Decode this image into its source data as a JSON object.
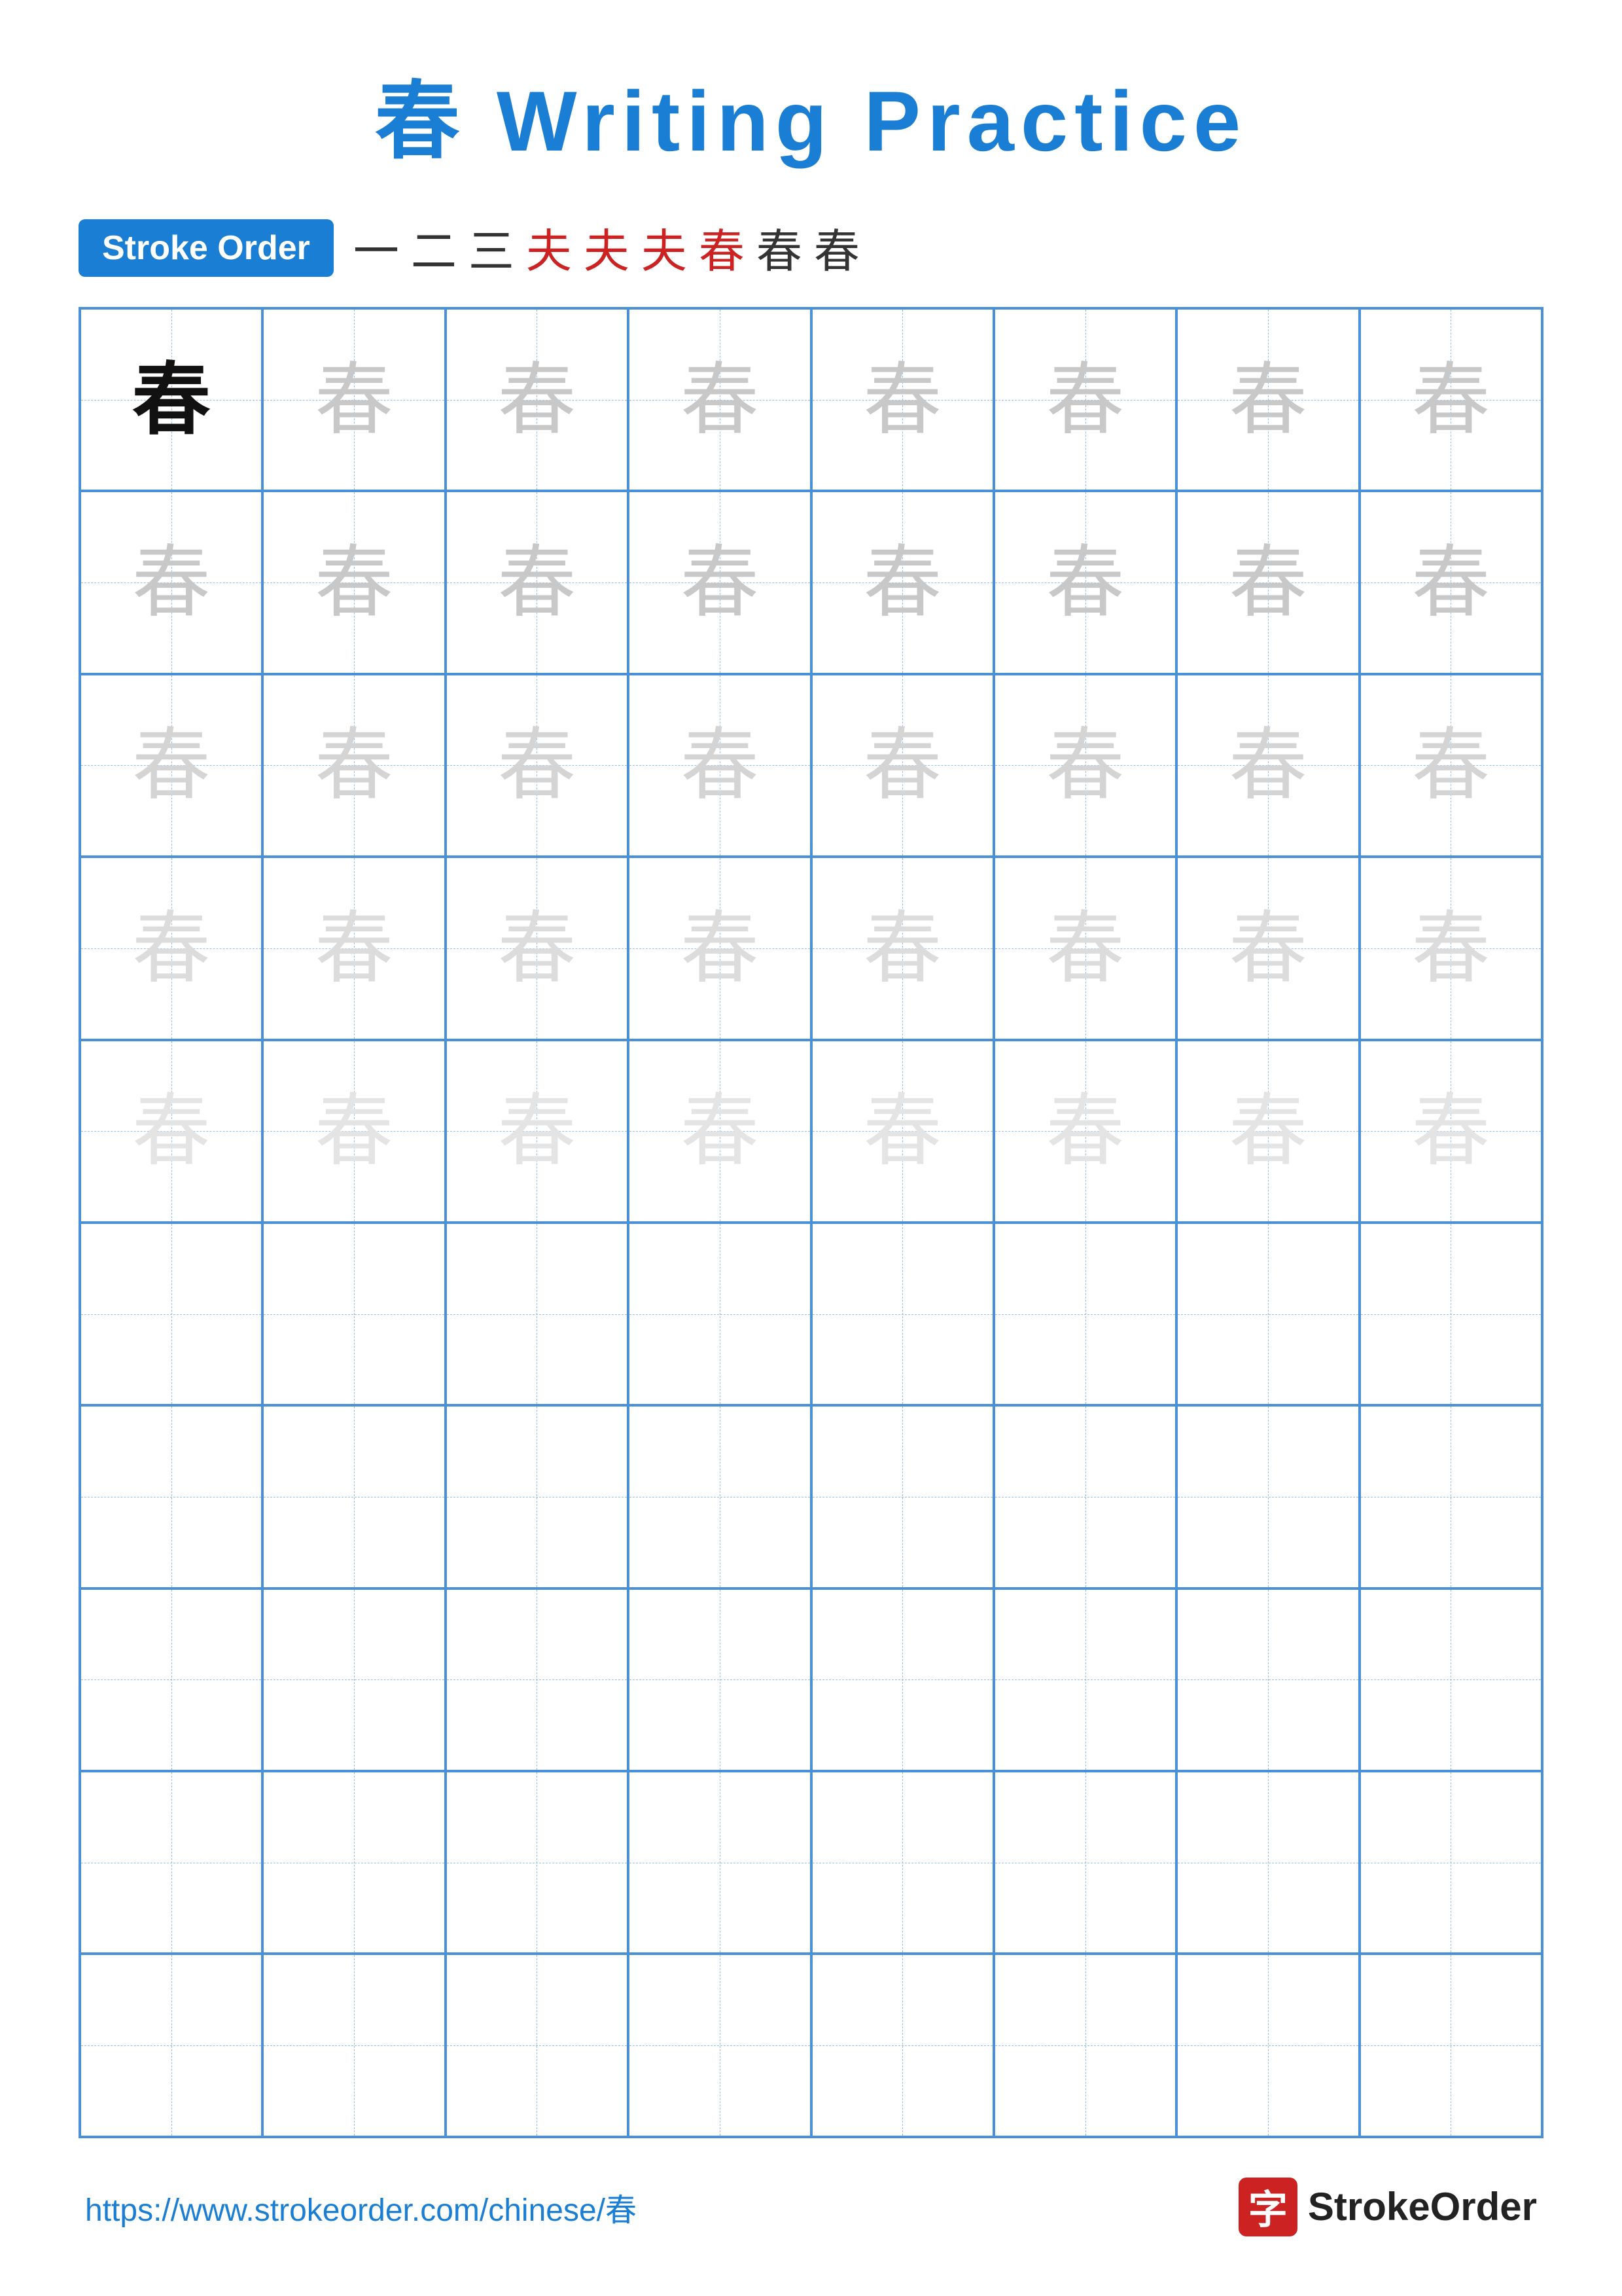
{
  "title": {
    "char": "春",
    "text": " Writing Practice"
  },
  "stroke_order": {
    "badge": "Stroke Order",
    "sequence": [
      {
        "char": "一",
        "style": "normal"
      },
      {
        "char": "二",
        "style": "normal"
      },
      {
        "char": "三",
        "style": "normal"
      },
      {
        "char": "夫",
        "style": "red"
      },
      {
        "char": "夫",
        "style": "red"
      },
      {
        "char": "夫",
        "style": "red"
      },
      {
        "char": "春",
        "style": "red"
      },
      {
        "char": "春",
        "style": "normal"
      },
      {
        "char": "春",
        "style": "normal"
      }
    ]
  },
  "grid": {
    "rows": 10,
    "cols": 8,
    "character": "春",
    "practice_char": "春",
    "row_opacities": [
      "dark",
      "light1",
      "light1",
      "light2",
      "light3",
      "light3",
      "light4",
      "light4",
      "light4",
      "light4"
    ]
  },
  "footer": {
    "url": "https://www.strokeorder.com/chinese/春",
    "brand": "StrokeOrder",
    "logo_char": "字"
  }
}
